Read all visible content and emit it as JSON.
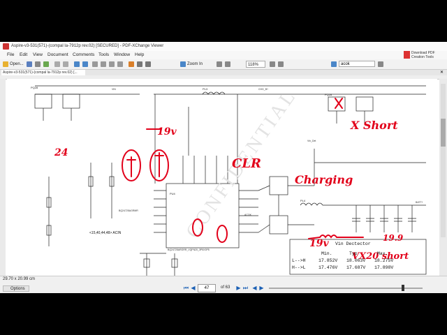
{
  "window": {
    "title": "Aspire-v3-531(571)-(compal la-7912p rev.02) [SECURED] - PDF-XChange Viewer",
    "download_promo": "Download PDF Creation Tools"
  },
  "menu": [
    "File",
    "Edit",
    "View",
    "Document",
    "Comments",
    "Tools",
    "Window",
    "Help"
  ],
  "toolbar": {
    "open_label": "Open...",
    "zoom_label": "Zoom In",
    "zoom_value": "118%",
    "search_value": "acok"
  },
  "tab": {
    "label": "Aspire-v3-531(571)-(compal la-7912p rev.02) [..."
  },
  "schematic": {
    "annotations": [
      "19v",
      "CLR",
      "Charging",
      "X Short",
      "24",
      "19v",
      "19.9",
      "VX20 short"
    ],
    "vin_detector": {
      "title": "Vin Dectector",
      "headers": [
        "Min.",
        "Typ",
        "Max."
      ],
      "rows": [
        {
          "label": "L-->H",
          "min": "17.852V",
          "typ": "18.063V",
          "max": "18.275V"
        },
        {
          "label": "H-->L",
          "min": "17.476V",
          "typ": "17.687V",
          "max": "17.898V"
        }
      ]
    },
    "net_label": "<15,40,44,48> ACIN",
    "labels": [
      "BQ24725ARGRR_VQFN20_3P5X3P5",
      "Vin_Det",
      "CHG_B+",
      "VIN",
      "BATT+",
      "ACOK",
      "BQ24725AGRMR"
    ]
  },
  "status": {
    "page_size": "29.70 x 20.99 cm",
    "options_label": "Options",
    "current_page": "47",
    "page_total": "of 63"
  }
}
